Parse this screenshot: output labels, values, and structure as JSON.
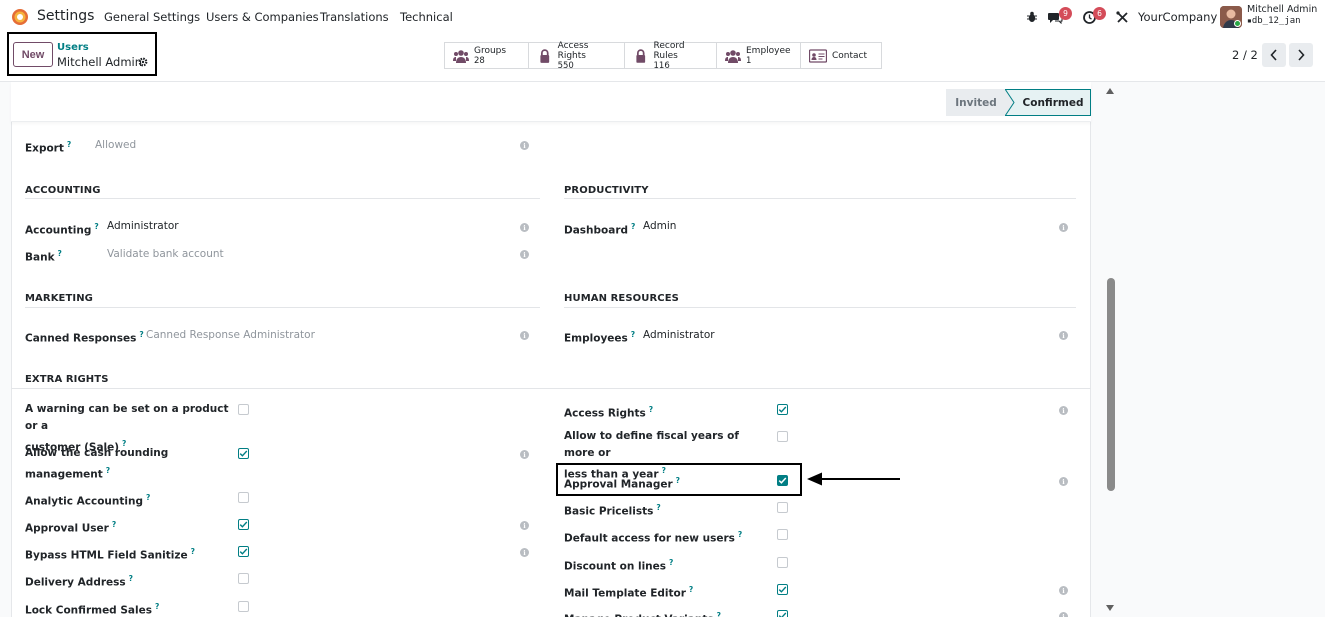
{
  "nav": {
    "app_title": "Settings",
    "menus": [
      "General Settings",
      "Users & Companies",
      "Translations",
      "Technical"
    ],
    "chat_count": "9",
    "activity_count": "6",
    "company": "YourCompany",
    "user_name": "Mitchell Admin",
    "db_name": "db_12_jan"
  },
  "control": {
    "new_label": "New",
    "breadcrumb_parent": "Users",
    "breadcrumb_current": "Mitchell Admin",
    "pager": "2 / 2",
    "smart_buttons": [
      {
        "label": "Groups",
        "value": "28",
        "icon": "users-icon"
      },
      {
        "label": "Access Rights",
        "value": "550",
        "icon": "lock-icon"
      },
      {
        "label": "Record Rules",
        "value": "116",
        "icon": "lock-icon"
      },
      {
        "label": "Employee",
        "value": "1",
        "icon": "users-icon"
      },
      {
        "label": "Contact",
        "value": "",
        "icon": "id-card-icon"
      }
    ]
  },
  "status": {
    "invited": "Invited",
    "confirmed": "Confirmed"
  },
  "form": {
    "export_label": "Export",
    "export_value": "Allowed",
    "accounting_title": "ACCOUNTING",
    "productivity_title": "PRODUCTIVITY",
    "accounting_label": "Accounting",
    "accounting_value": "Administrator",
    "bank_label": "Bank",
    "bank_placeholder": "Validate bank account",
    "dashboard_label": "Dashboard",
    "dashboard_value": "Admin",
    "marketing_title": "MARKETING",
    "hr_title": "HUMAN RESOURCES",
    "canned_label": "Canned Responses",
    "canned_placeholder": "Canned Response Administrator",
    "employees_label": "Employees",
    "employees_value": "Administrator",
    "extra_title": "EXTRA RIGHTS",
    "left_rights": [
      {
        "line1": "A warning can be set on a product or a",
        "line2": "customer (Sale)",
        "checked": false
      },
      {
        "line1": "Allow the cash rounding",
        "line2": "management",
        "checked": true
      },
      {
        "line1": "Analytic Accounting",
        "line2": "",
        "checked": false
      },
      {
        "line1": "Approval User",
        "line2": "",
        "checked": true
      },
      {
        "line1": "Bypass HTML Field Sanitize",
        "line2": "",
        "checked": true
      },
      {
        "line1": "Delivery Address",
        "line2": "",
        "checked": false
      },
      {
        "line1": "Lock Confirmed Sales",
        "line2": "",
        "checked": false
      }
    ],
    "right_rights": [
      {
        "line1": "Access Rights",
        "line2": "",
        "checked": true
      },
      {
        "line1": "Allow to define fiscal years of more or",
        "line2": "less than a year",
        "checked": false
      },
      {
        "line1": "Approval Manager",
        "line2": "",
        "checked": true
      },
      {
        "line1": "Basic Pricelists",
        "line2": "",
        "checked": false
      },
      {
        "line1": "Default access for new users",
        "line2": "",
        "checked": false
      },
      {
        "line1": "Discount on lines",
        "line2": "",
        "checked": false
      },
      {
        "line1": "Mail Template Editor",
        "line2": "",
        "checked": true
      },
      {
        "line1": "Manage Product Variants",
        "line2": "",
        "checked": true
      }
    ]
  },
  "help_mark": "?",
  "info_mark": "i",
  "colors": {
    "accent": "#017e84",
    "brand": "#714b67",
    "badge": "#d44c59"
  }
}
